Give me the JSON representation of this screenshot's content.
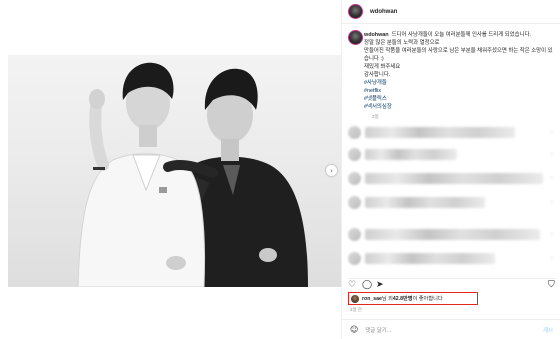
{
  "post": {
    "username": "wdohwan",
    "verified_icon": "verified-badge-icon",
    "caption": {
      "username": "wdohwan",
      "lines": [
        "드디어 사냥개들이 오늘 여러분들께 인사를 드리게 되었습니다.",
        "정말 많은 분들의 노력과 열정으로",
        "만들어진 작품을 여러분들의 사랑으로 남은 부분을 채워주셨으면 하는 작은 소망이 있습니다 :)",
        "재밌게 봐주세요",
        "감사합니다."
      ],
      "hashtags": [
        "#사냥개들",
        "#netflix",
        "#넷플릭스",
        "#넥서의심장"
      ],
      "time": "2일"
    },
    "image": {
      "carousel_dots": 3,
      "active_dot": 0,
      "next_icon": "chevron-right-icon"
    },
    "actions": {
      "like_icon": "heart-icon",
      "comment_icon": "comment-bubble-icon",
      "share_icon": "paper-plane-icon",
      "save_icon": "bookmark-icon"
    },
    "likes": {
      "user": "ron_sae",
      "mid": "님 외 ",
      "count": "42.8만명",
      "suffix": "이 좋아합니다"
    },
    "post_time": "2일 전",
    "comment_box": {
      "emoji_icon": "smiley-icon",
      "placeholder": "댓글 달기...",
      "post_label": "게시"
    }
  }
}
